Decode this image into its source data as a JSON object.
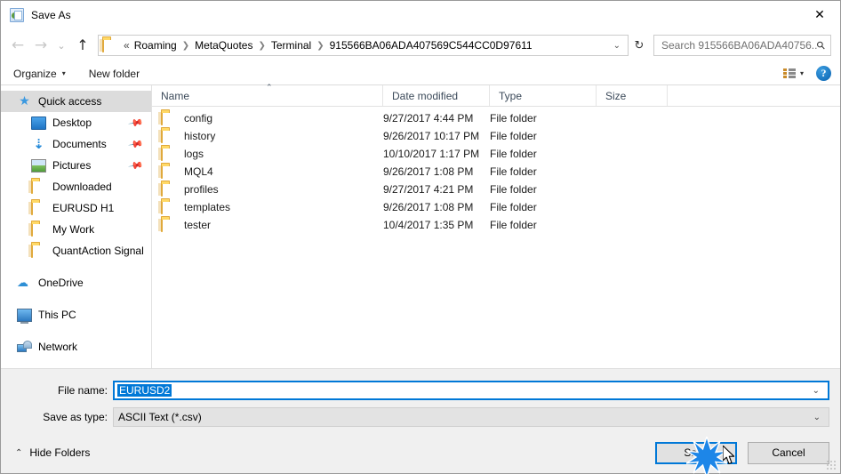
{
  "window": {
    "title": "Save As",
    "icon": "save-as-icon",
    "close_label": "✕"
  },
  "address_bar": {
    "back_icon": "←",
    "forward_icon": "→",
    "recent_icon": "⌄",
    "up_icon": "↑",
    "folder_icon": "folder-icon",
    "double_chevron": "«",
    "separator": "❯",
    "breadcrumbs": [
      "Roaming",
      "MetaQuotes",
      "Terminal",
      "915566BA06ADA407569C544CC0D97611"
    ],
    "dropdown_icon": "⌄",
    "refresh_icon": "↻",
    "search_placeholder": "Search 915566BA06ADA40756...",
    "search_value": "",
    "search_icon": "⚲"
  },
  "toolbar": {
    "organize_label": "Organize",
    "organize_caret": "▾",
    "new_folder_label": "New folder",
    "view_caret": "▾",
    "help_label": "?"
  },
  "sidebar": {
    "groups": [
      {
        "items": [
          {
            "label": "Quick access",
            "icon": "star-icon",
            "selected": true,
            "pinned": false,
            "indent": false
          },
          {
            "label": "Desktop",
            "icon": "desktop-icon",
            "selected": false,
            "pinned": true,
            "indent": true
          },
          {
            "label": "Documents",
            "icon": "documents-icon",
            "selected": false,
            "pinned": true,
            "indent": true
          },
          {
            "label": "Pictures",
            "icon": "pictures-icon",
            "selected": false,
            "pinned": true,
            "indent": true
          },
          {
            "label": "Downloaded",
            "icon": "folder-icon",
            "selected": false,
            "pinned": false,
            "indent": true
          },
          {
            "label": "EURUSD H1",
            "icon": "folder-icon",
            "selected": false,
            "pinned": false,
            "indent": true
          },
          {
            "label": "My Work",
            "icon": "folder-icon",
            "selected": false,
            "pinned": false,
            "indent": true
          },
          {
            "label": "QuantAction Signal",
            "icon": "folder-icon",
            "selected": false,
            "pinned": false,
            "indent": true
          }
        ]
      },
      {
        "items": [
          {
            "label": "OneDrive",
            "icon": "onedrive-icon",
            "selected": false,
            "pinned": false,
            "indent": false
          }
        ]
      },
      {
        "items": [
          {
            "label": "This PC",
            "icon": "this-pc-icon",
            "selected": false,
            "pinned": false,
            "indent": false
          }
        ]
      },
      {
        "items": [
          {
            "label": "Network",
            "icon": "network-icon",
            "selected": false,
            "pinned": false,
            "indent": false
          }
        ]
      }
    ]
  },
  "file_list": {
    "columns": [
      "Name",
      "Date modified",
      "Type",
      "Size"
    ],
    "sort_indicator": "⌃",
    "rows": [
      {
        "name": "config",
        "date": "9/27/2017 4:44 PM",
        "type": "File folder",
        "size": ""
      },
      {
        "name": "history",
        "date": "9/26/2017 10:17 PM",
        "type": "File folder",
        "size": ""
      },
      {
        "name": "logs",
        "date": "10/10/2017 1:17 PM",
        "type": "File folder",
        "size": ""
      },
      {
        "name": "MQL4",
        "date": "9/26/2017 1:08 PM",
        "type": "File folder",
        "size": ""
      },
      {
        "name": "profiles",
        "date": "9/27/2017 4:21 PM",
        "type": "File folder",
        "size": ""
      },
      {
        "name": "templates",
        "date": "9/26/2017 1:08 PM",
        "type": "File folder",
        "size": ""
      },
      {
        "name": "tester",
        "date": "10/4/2017 1:35 PM",
        "type": "File folder",
        "size": ""
      }
    ]
  },
  "form": {
    "file_name_label": "File name:",
    "file_name_value": "EURUSD2",
    "file_name_chevron": "⌄",
    "save_as_type_label": "Save as type:",
    "save_as_type_value": "ASCII Text (*.csv)",
    "save_as_type_chevron": "⌄"
  },
  "footer": {
    "hide_folders_label": "Hide Folders",
    "hide_folders_chevron": "⌃",
    "save_label": "Save",
    "cancel_label": "Cancel"
  },
  "colors": {
    "accent": "#0078d7",
    "selection": "#0078d7",
    "folder": "#ffd966",
    "chrome": "#f0f0f0"
  }
}
